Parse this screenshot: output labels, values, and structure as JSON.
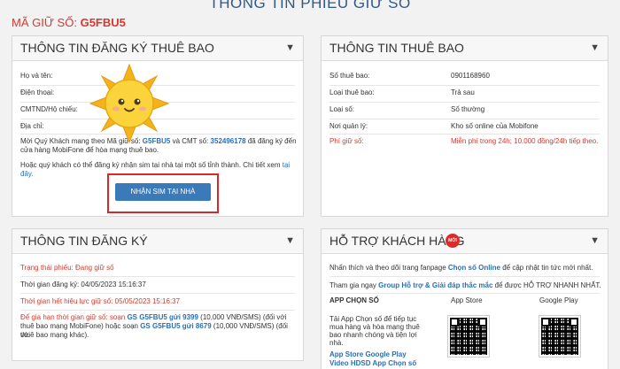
{
  "page_title": "THÔNG TIN PHIẾU GIỮ SỐ",
  "ticket": {
    "label": "MÃ GIỮ SỐ:",
    "code": "G5FBU5"
  },
  "registration_panel": {
    "title": "THÔNG TIN ĐĂNG KÝ THUÊ BAO",
    "fields": [
      {
        "label": "Họ và tên:"
      },
      {
        "label": "Điện thoại:"
      },
      {
        "label": "CMTND/Hộ chiếu:"
      },
      {
        "label": "Địa chỉ:"
      }
    ],
    "invite_prefix": "Mời Quý Khách mang theo Mã giữ số: ",
    "invite_code": "G5FBU5",
    "invite_mid": " và CMT số: ",
    "invite_id": "352496178",
    "invite_suffix": " đã đăng ký đến",
    "invite_line2": "cửa hàng MobiFone để hòa mạng thuê bao.",
    "alt_text": "Hoặc quý khách có thể đăng ký nhận sim tại nhà tại một số tỉnh thành. Chi tiết xem ",
    "alt_link1": "tại",
    "alt_link2": "đây.",
    "home_sim_button": "NHẬN SIM TẠI NHÀ"
  },
  "subscriber_panel": {
    "title": "THÔNG TIN THUÊ BAO",
    "rows": [
      {
        "label": "Số thuê bao:",
        "value": "0901168960"
      },
      {
        "label": "Loại thuê bao:",
        "value": "Trả sau"
      },
      {
        "label": "Loại số:",
        "value": "Số thường"
      },
      {
        "label": "Nơi quản lý:",
        "value": "Kho số online của Mobifone"
      },
      {
        "label": "Phí giữ số:",
        "value": "Miễn phí trong 24h; 10.000 đồng/24h tiếp theo."
      }
    ]
  },
  "status_panel": {
    "title": "THÔNG TIN ĐĂNG KÝ",
    "status": "Trạng thái phiếu: Đang giữ số",
    "registered_time": "Thời gian đăng ký: 04/05/2023 15:16:37",
    "expiry_time": "Thời gian hết hiệu lực giữ số: 05/05/2023 15:16:37",
    "extend_line1_a": "Để gia hạn thời gian giữ số: soạn ",
    "extend_code1": "GS G5FBU5 gửi 9399",
    "extend_line1_b": " (10,000 VNĐ/SMS) (đối với",
    "extend_line2_a": "thuê bao mạng MobiFone) hoặc soạn ",
    "extend_code2": "GS G5FBU5 gửi 8679",
    "extend_line2_b": " (10,000 VNĐ/SMS) (đối với",
    "extend_line3": "thuê bao mạng khác)."
  },
  "support_panel": {
    "title": "HỖ TRỢ KHÁCH HÀNG",
    "badge": "MỚI",
    "line1_a": "Nhấn thích và theo dõi trang fanpage ",
    "line1_link": "Chọn số Online",
    "line1_b": " để cập nhật tin tức mới nhất.",
    "line2_a": "Tham gia ngay ",
    "line2_link": "Group Hỗ trợ & Giải đáp thắc mắc",
    "line2_b": " để được HỖ TRỢ NHANH NHẤT.",
    "app_heading": "APP CHỌN SỐ",
    "app_store": "App Store",
    "google_play": "Google Play",
    "app_desc": [
      "Tải App Chọn số để tiếp tục",
      "mua hàng và hòa mạng thuê",
      "bao nhanh chóng và tiện lợi",
      "nhà."
    ],
    "link_stores": "App Store Google Play",
    "link_video": "Video HDSD App Chọn số"
  },
  "icons": {
    "chevron": "chevron-down-icon",
    "sun": "sun-sticker-icon"
  },
  "colors": {
    "accent_blue": "#3b7ab8",
    "alert_red": "#d33a2f",
    "highlight_red": "#d9272e"
  }
}
